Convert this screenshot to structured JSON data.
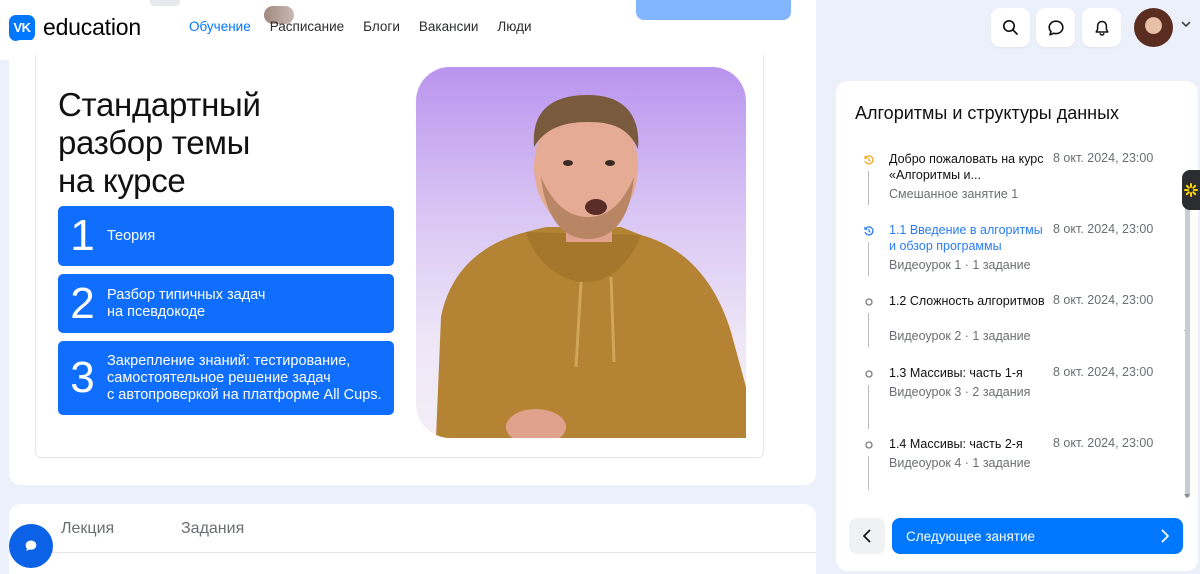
{
  "brand": {
    "logo_text": "VK",
    "name": "education"
  },
  "nav": {
    "items": [
      "Обучение",
      "Расписание",
      "Блоги",
      "Вакансии",
      "Люди"
    ],
    "active": 0
  },
  "header_icons": [
    "search-icon",
    "chat-icon",
    "bell-icon"
  ],
  "slide": {
    "title_lines": [
      "Стандартный",
      "разбор темы",
      "на курсе"
    ],
    "steps": [
      {
        "num": "1",
        "text": [
          "Теория"
        ]
      },
      {
        "num": "2",
        "text": [
          "Разбор типичных задач",
          "на псевдокоде"
        ]
      },
      {
        "num": "3",
        "text": [
          "Закрепление знаний: тестирование,",
          "самостоятельное решение задач",
          "с автопроверкой на платформе All Cups."
        ]
      }
    ]
  },
  "tabs": [
    "Лекция",
    "Задания"
  ],
  "sidebar": {
    "title": "Алгоритмы и структуры данных",
    "lessons": [
      {
        "title": "Добро пожаловать на курс «Алгоритмы и...",
        "sub": "Смешанное занятие 1",
        "date": "8 окт. 2024, 23:00",
        "state": "history",
        "active": false
      },
      {
        "title": "1.1 Введение в алгоритмы и обзор программы",
        "sub": "Видеоурок 1 · 1 задание",
        "date": "8 окт. 2024, 23:00",
        "state": "history",
        "active": true
      },
      {
        "title": "1.2 Сложность алгоритмов",
        "sub": "Видеоурок 2 · 1 задание",
        "date": "8 окт. 2024, 23:00",
        "state": "circle",
        "active": false
      },
      {
        "title": "1.3 Массивы: часть 1-я",
        "sub": "Видеоурок 3 · 2 задания",
        "date": "8 окт. 2024, 23:00",
        "state": "circle",
        "active": false
      },
      {
        "title": "1.4 Массивы: часть 2-я",
        "sub": "Видеоурок 4 · 1 задание",
        "date": "8 окт. 2024, 23:00",
        "state": "circle",
        "active": false
      }
    ],
    "next_label": "Следующее занятие"
  },
  "colors": {
    "accent": "#0077ff",
    "step_bg": "#0f6efd",
    "history_orange": "#f5a623",
    "active_blue": "#2a7cf3"
  }
}
